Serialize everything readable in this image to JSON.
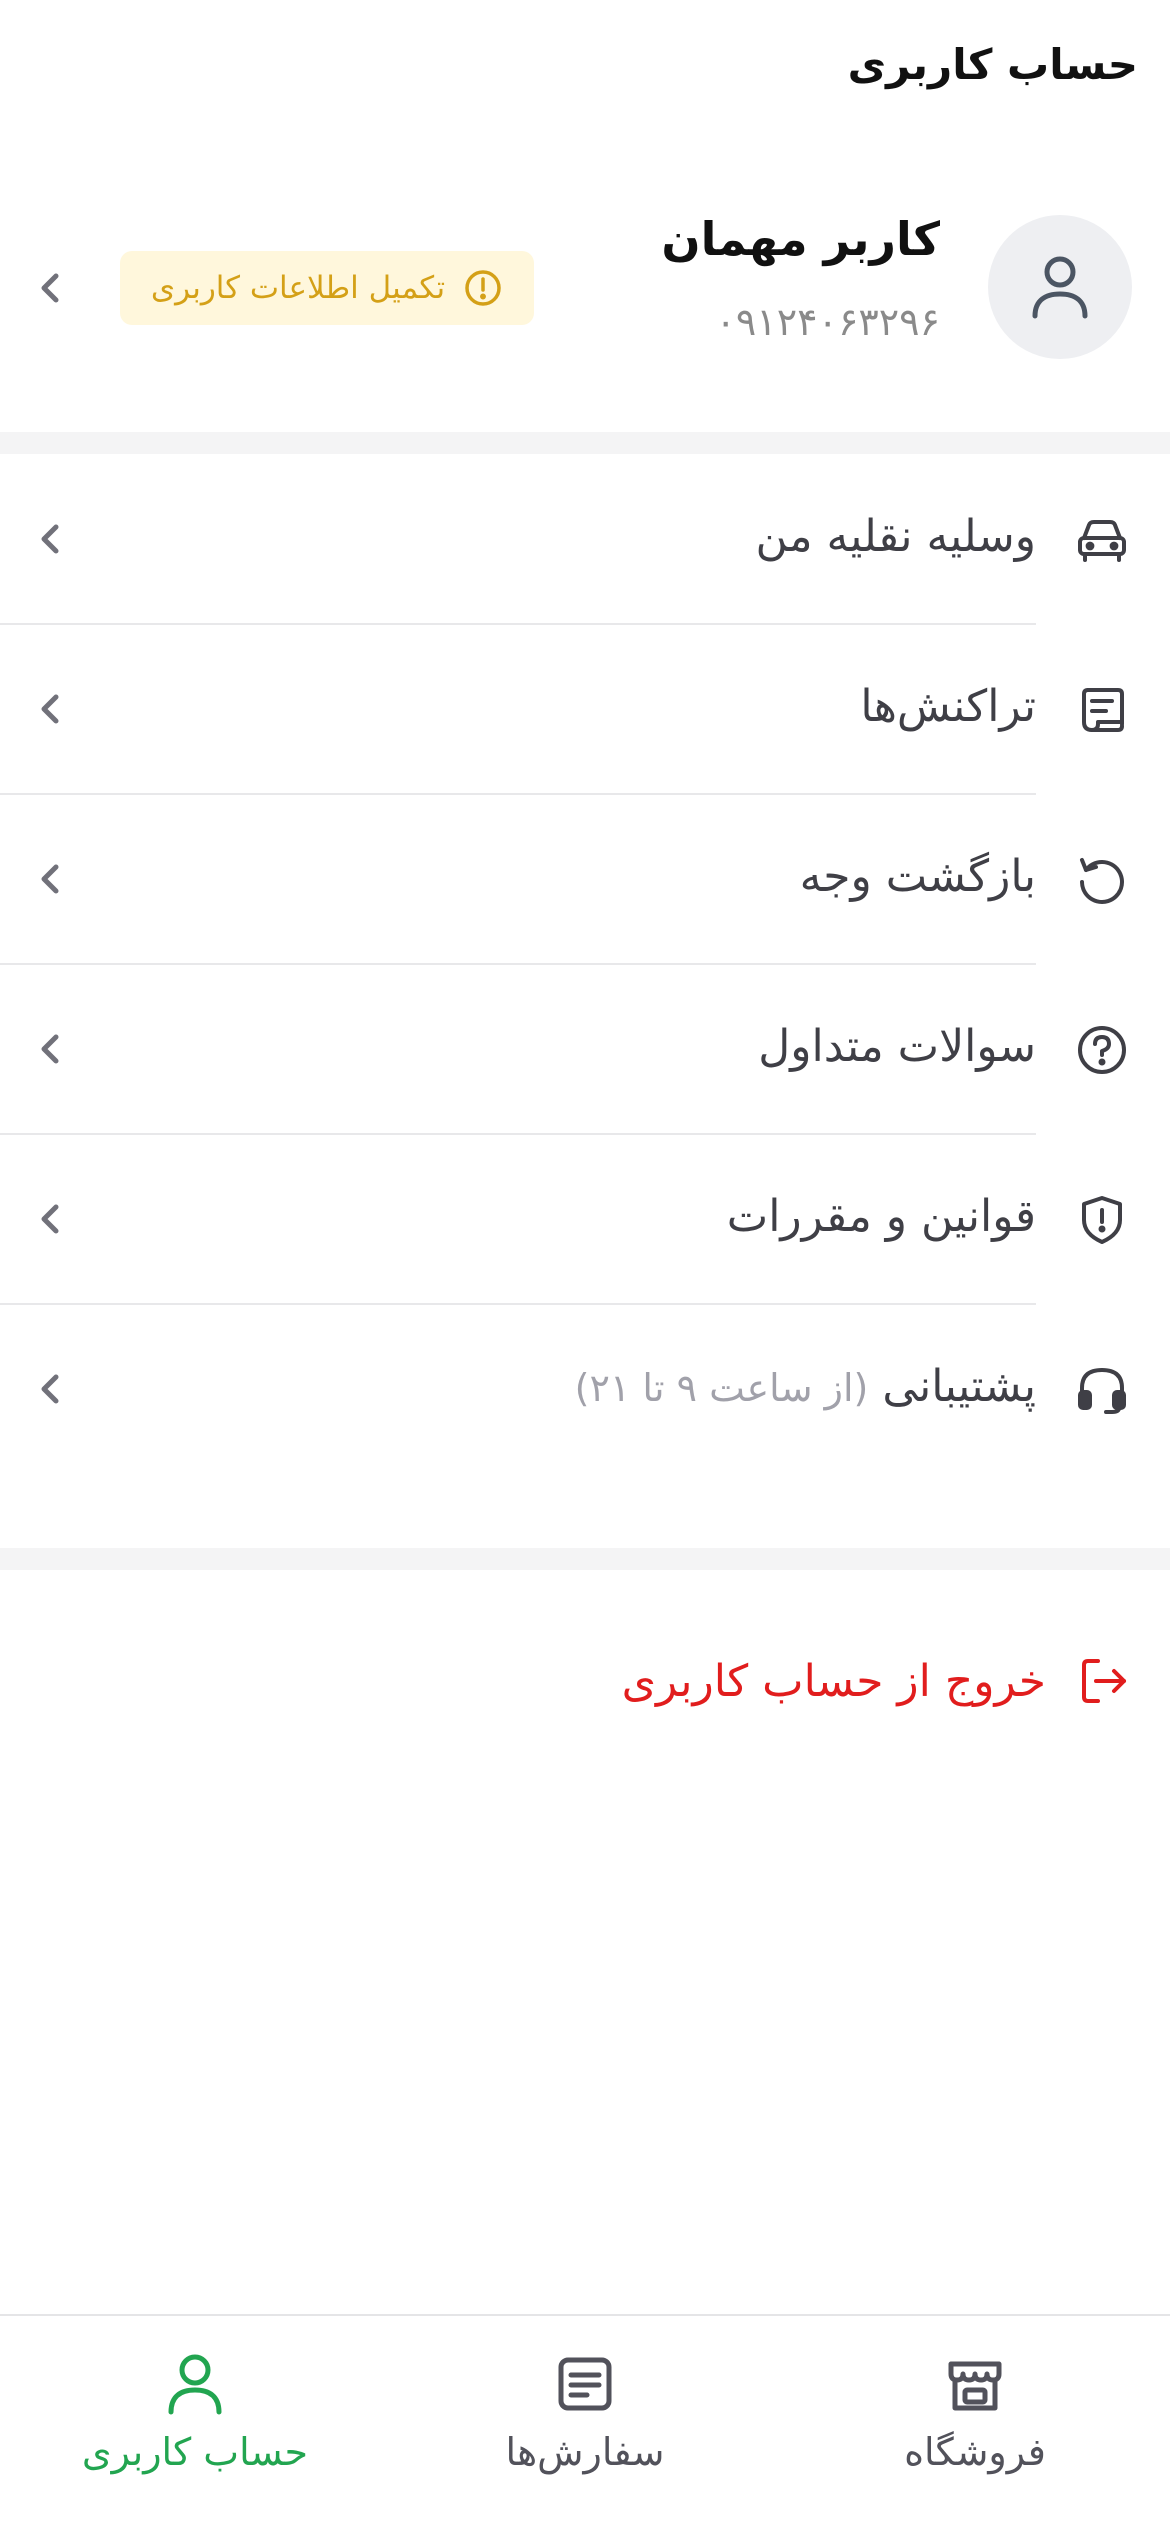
{
  "header": {
    "title": "حساب کاربری"
  },
  "profile": {
    "name": "کاربر مهمان",
    "phone": "۰۹۱۲۴۰۶۳۲۹۶",
    "complete_info_label": "تکمیل اطلاعات کاربری",
    "avatar_icon": "user-icon",
    "badge_color": "#d4a017"
  },
  "menu": {
    "items": [
      {
        "label": "وسلیه نقلیه من",
        "icon": "car-icon"
      },
      {
        "label": "تراکنش‌ها",
        "icon": "receipt-icon"
      },
      {
        "label": "بازگشت وجه",
        "icon": "refund-icon"
      },
      {
        "label": "سوالات متداول",
        "icon": "question-icon"
      },
      {
        "label": "قوانین و مقررات",
        "icon": "shield-alert-icon"
      },
      {
        "label": "پشتیبانی",
        "hint": "(از ساعت ۹ تا ۲۱)",
        "icon": "headset-icon"
      }
    ]
  },
  "logout": {
    "label": "خروج از حساب کاربری",
    "color": "#e11d1d"
  },
  "bottom_nav": {
    "active_color": "#22a550",
    "inactive_color": "#52525b",
    "items": [
      {
        "label": "حساب کاربری",
        "icon": "user-icon",
        "active": true
      },
      {
        "label": "سفارش‌ها",
        "icon": "orders-icon",
        "active": false
      },
      {
        "label": "فروشگاه",
        "icon": "store-icon",
        "active": false
      }
    ]
  }
}
